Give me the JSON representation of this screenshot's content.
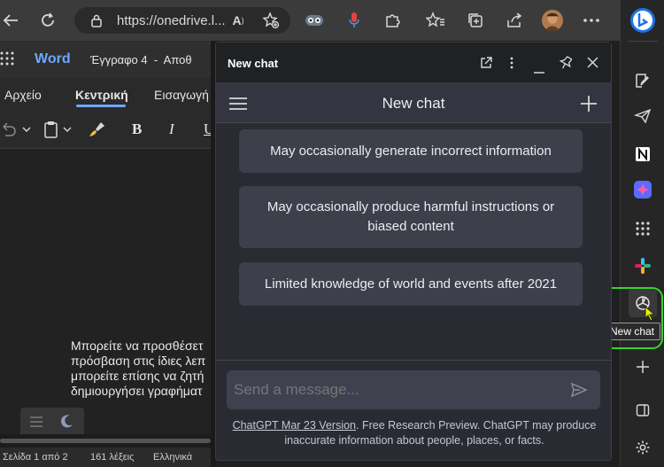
{
  "browser": {
    "url": "https://onedrive.l...",
    "colors": {
      "toolbar": "#3b3b3b",
      "mic": "#e0443e",
      "bing": "#1a73e8"
    }
  },
  "word": {
    "app_name": "Word",
    "doc_title": "Έγγραφο 4  -  Αποθ",
    "tabs": [
      "Αρχείο",
      "Κεντρική",
      "Εισαγωγή"
    ],
    "body_lines": [
      "Μπορείτε να προσθέσετ",
      "πρόσβαση στις ίδιες λεπ",
      "μπορείτε επίσης να ζητή",
      "δημιουργήσει γραφήματ"
    ],
    "status": {
      "page": "Σελίδα 1 από 2",
      "words": "161 λέξεις",
      "language": "Ελληνικά"
    }
  },
  "chat": {
    "window_title": "New chat",
    "nav_title": "New chat",
    "cards": [
      "May occasionally generate incorrect information",
      "May occasionally produce harmful instructions or biased content",
      "Limited knowledge of world and events after 2021"
    ],
    "input_placeholder": "Send a message...",
    "footer_link": "ChatGPT Mar 23 Version",
    "footer_text": ". Free Research Preview. ChatGPT may produce inaccurate information about people, places, or facts."
  },
  "sidebar": {
    "tooltip": "New chat",
    "highlight_color": "#39d22f"
  }
}
